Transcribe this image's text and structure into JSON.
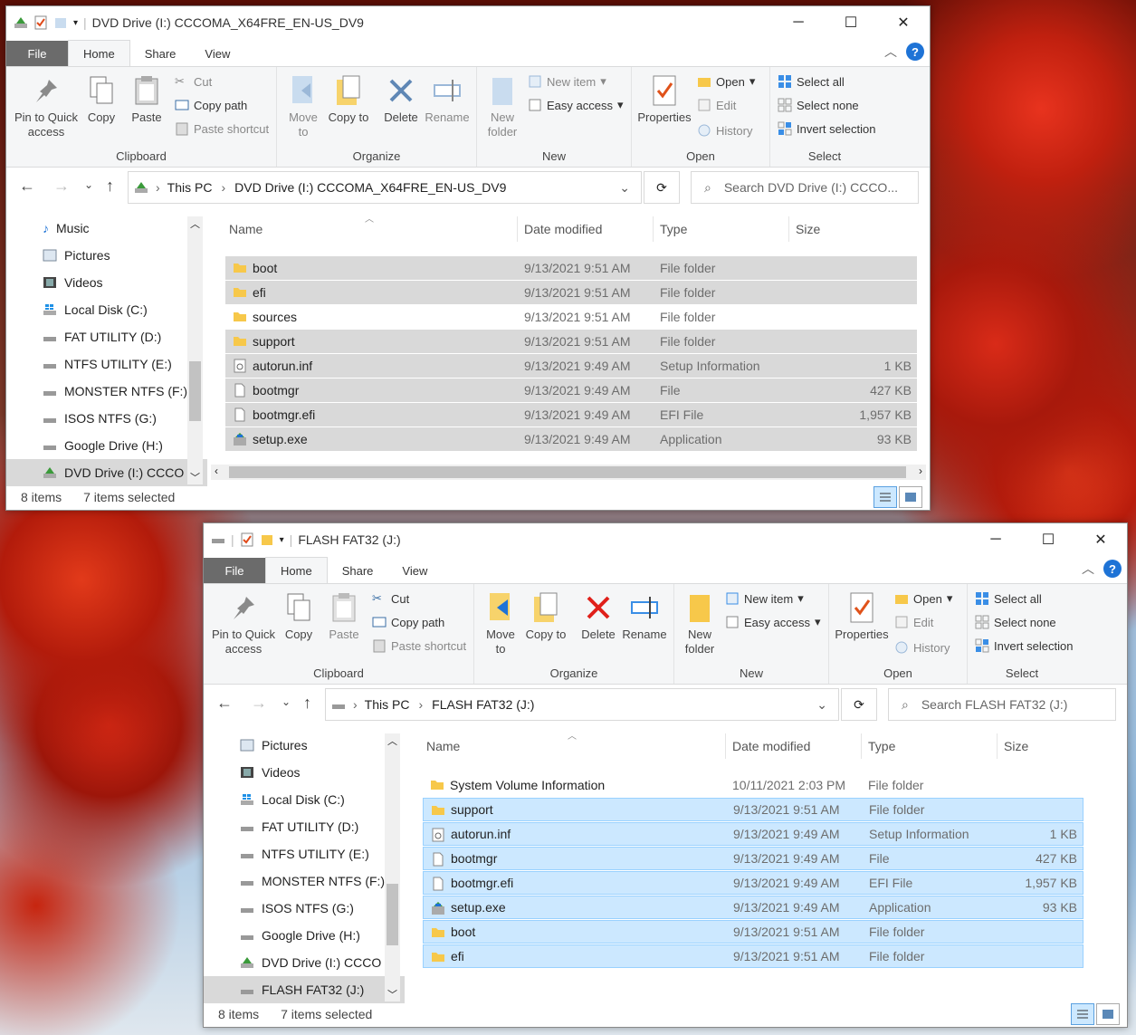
{
  "window1": {
    "title": "DVD Drive (I:) CCCOMA_X64FRE_EN-US_DV9",
    "tabs": [
      "File",
      "Home",
      "Share",
      "View"
    ],
    "ribbon": {
      "pin": "Pin to Quick access",
      "copy": "Copy",
      "paste": "Paste",
      "cut": "Cut",
      "copy_path": "Copy path",
      "paste_shortcut": "Paste shortcut",
      "move_to": "Move to",
      "copy_to": "Copy to",
      "delete": "Delete",
      "rename": "Rename",
      "new_folder": "New folder",
      "new_item": "New item",
      "easy_access": "Easy access",
      "properties": "Properties",
      "open": "Open",
      "edit": "Edit",
      "history": "History",
      "select_all": "Select all",
      "select_none": "Select none",
      "invert_selection": "Invert selection",
      "groups": {
        "clipboard": "Clipboard",
        "organize": "Organize",
        "new": "New",
        "open": "Open",
        "select": "Select"
      }
    },
    "address": {
      "crumb1": "This PC",
      "crumb2": "DVD Drive (I:) CCCOMA_X64FRE_EN-US_DV9",
      "search": "Search DVD Drive (I:) CCCO..."
    },
    "nav": [
      "Music",
      "Pictures",
      "Videos",
      "Local Disk (C:)",
      "FAT UTILITY (D:)",
      "NTFS UTILITY (E:)",
      "MONSTER NTFS (F:)",
      "ISOS NTFS (G:)",
      "Google Drive (H:)",
      "DVD Drive (I:) CCCO"
    ],
    "columns": {
      "name": "Name",
      "date": "Date modified",
      "type": "Type",
      "size": "Size"
    },
    "files": [
      {
        "name": "boot",
        "date": "9/13/2021 9:51 AM",
        "type": "File folder",
        "size": "",
        "icon": "folder-icon",
        "selected": true
      },
      {
        "name": "efi",
        "date": "9/13/2021 9:51 AM",
        "type": "File folder",
        "size": "",
        "icon": "folder-icon",
        "selected": true
      },
      {
        "name": "sources",
        "date": "9/13/2021 9:51 AM",
        "type": "File folder",
        "size": "",
        "icon": "folder-icon",
        "selected": false
      },
      {
        "name": "support",
        "date": "9/13/2021 9:51 AM",
        "type": "File folder",
        "size": "",
        "icon": "folder-icon",
        "selected": true
      },
      {
        "name": "autorun.inf",
        "date": "9/13/2021 9:49 AM",
        "type": "Setup Information",
        "size": "1 KB",
        "icon": "settings-file-icon",
        "selected": true
      },
      {
        "name": "bootmgr",
        "date": "9/13/2021 9:49 AM",
        "type": "File",
        "size": "427 KB",
        "icon": "file-icon",
        "selected": true
      },
      {
        "name": "bootmgr.efi",
        "date": "9/13/2021 9:49 AM",
        "type": "EFI File",
        "size": "1,957 KB",
        "icon": "file-icon",
        "selected": true
      },
      {
        "name": "setup.exe",
        "date": "9/13/2021 9:49 AM",
        "type": "Application",
        "size": "93 KB",
        "icon": "setup-icon",
        "selected": true
      }
    ],
    "status": {
      "items": "8 items",
      "selected": "7 items selected"
    }
  },
  "window2": {
    "title": "FLASH FAT32 (J:)",
    "tabs": [
      "File",
      "Home",
      "Share",
      "View"
    ],
    "ribbon": {
      "pin": "Pin to Quick access",
      "copy": "Copy",
      "paste": "Paste",
      "cut": "Cut",
      "copy_path": "Copy path",
      "paste_shortcut": "Paste shortcut",
      "move_to": "Move to",
      "copy_to": "Copy to",
      "delete": "Delete",
      "rename": "Rename",
      "new_folder": "New folder",
      "new_item": "New item",
      "easy_access": "Easy access",
      "properties": "Properties",
      "open": "Open",
      "edit": "Edit",
      "history": "History",
      "select_all": "Select all",
      "select_none": "Select none",
      "invert_selection": "Invert selection",
      "groups": {
        "clipboard": "Clipboard",
        "organize": "Organize",
        "new": "New",
        "open": "Open",
        "select": "Select"
      }
    },
    "address": {
      "crumb1": "This PC",
      "crumb2": "FLASH FAT32 (J:)",
      "search": "Search FLASH FAT32 (J:)"
    },
    "nav": [
      "Pictures",
      "Videos",
      "Local Disk (C:)",
      "FAT UTILITY (D:)",
      "NTFS UTILITY (E:)",
      "MONSTER NTFS (F:)",
      "ISOS NTFS (G:)",
      "Google Drive (H:)",
      "DVD Drive (I:) CCCO",
      "FLASH FAT32 (J:)"
    ],
    "columns": {
      "name": "Name",
      "date": "Date modified",
      "type": "Type",
      "size": "Size"
    },
    "files": [
      {
        "name": "System Volume Information",
        "date": "10/11/2021 2:03 PM",
        "type": "File folder",
        "size": "",
        "icon": "folder-icon",
        "selected": false
      },
      {
        "name": "support",
        "date": "9/13/2021 9:51 AM",
        "type": "File folder",
        "size": "",
        "icon": "folder-icon",
        "selected": true
      },
      {
        "name": "autorun.inf",
        "date": "9/13/2021 9:49 AM",
        "type": "Setup Information",
        "size": "1 KB",
        "icon": "settings-file-icon",
        "selected": true
      },
      {
        "name": "bootmgr",
        "date": "9/13/2021 9:49 AM",
        "type": "File",
        "size": "427 KB",
        "icon": "file-icon",
        "selected": true
      },
      {
        "name": "bootmgr.efi",
        "date": "9/13/2021 9:49 AM",
        "type": "EFI File",
        "size": "1,957 KB",
        "icon": "file-icon",
        "selected": true
      },
      {
        "name": "setup.exe",
        "date": "9/13/2021 9:49 AM",
        "type": "Application",
        "size": "93 KB",
        "icon": "setup-icon",
        "selected": true
      },
      {
        "name": "boot",
        "date": "9/13/2021 9:51 AM",
        "type": "File folder",
        "size": "",
        "icon": "folder-icon",
        "selected": true
      },
      {
        "name": "efi",
        "date": "9/13/2021 9:51 AM",
        "type": "File folder",
        "size": "",
        "icon": "folder-icon",
        "selected": true
      }
    ],
    "status": {
      "items": "8 items",
      "selected": "7 items selected"
    }
  },
  "colors": {
    "accent": "#1e73d6",
    "selection_blue": "#cce8ff",
    "selection_gray": "#d9d9d9",
    "file_tab": "#6b6b6b"
  }
}
